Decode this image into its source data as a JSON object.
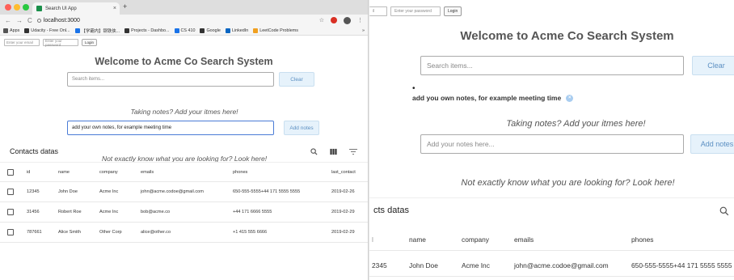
{
  "browser": {
    "tab_title": "Search UI App",
    "tab_close": "×",
    "new_tab": "+",
    "url": "localhost:3000",
    "nav_back": "←",
    "nav_forward": "→",
    "nav_reload": "C",
    "star": "☆",
    "menu": "⋮",
    "bookmarks": [
      {
        "label": "Apps",
        "color": "#555555"
      },
      {
        "label": "Udacity - Free Onl...",
        "color": "#333333"
      },
      {
        "label": "【学霸内】钢铁侠...",
        "color": "#1a73e8"
      },
      {
        "label": "Projects - Dashbo...",
        "color": "#333333"
      },
      {
        "label": "CS 410",
        "color": "#1a73e8"
      },
      {
        "label": "Google",
        "color": "#333333"
      },
      {
        "label": "LinkedIn",
        "color": "#0a66c2"
      },
      {
        "label": "LeetCode Problems",
        "color": "#f0a020"
      }
    ],
    "bookmarks_more": "»"
  },
  "login": {
    "email_placeholder": "Enter your email",
    "password_placeholder": "Enter your password",
    "login_label": "Login"
  },
  "app": {
    "title": "Welcome to Acme Co Search System",
    "search_placeholder": "Search items...",
    "clear_label": "Clear",
    "notes_prompt": "Taking notes? Add your itmes here!",
    "notes_value": "add your own notes, for example meeting time",
    "notes_placeholder": "Add your notes here...",
    "add_notes_label": "Add notes",
    "look_here": "Not exactly know what you are looking for? Look here!",
    "saved_note": "add you own notes, for example meeting time",
    "note_bullet": "•",
    "note_close": "×"
  },
  "table": {
    "title": "Contacts datas",
    "columns": [
      "id",
      "name",
      "company",
      "emails",
      "phones",
      "last_contact"
    ],
    "rows": [
      [
        "12345",
        "John Doe",
        "Acme Inc",
        "john@acme.codoe@gmail.com",
        "650-555-5555+44 171 5555 5555",
        "2019-02-26"
      ],
      [
        "31456",
        "Robert Roe",
        "Acme Inc",
        "bob@acme.co",
        "+44 171 6666 5555",
        "2019-02-29"
      ],
      [
        "787661",
        "Alice Smith",
        "Other Corp",
        "alice@other.co",
        "+1 415 555 6666",
        "2019-02-29"
      ]
    ]
  },
  "zoom": {
    "login_partial": "il",
    "password_placeholder": "Enter your password",
    "login_label": "Login",
    "table_title_partial": "cts datas",
    "row_id_partial": "2345",
    "col_checkbox_partial": "l"
  }
}
